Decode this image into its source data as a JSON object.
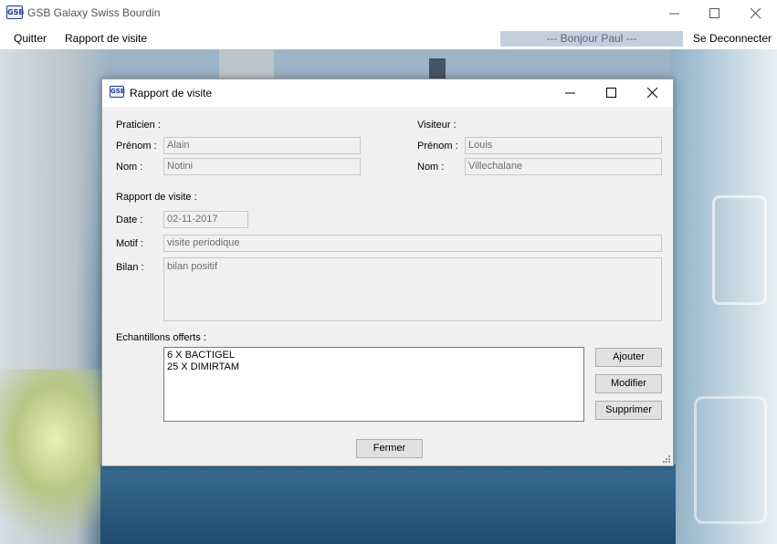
{
  "window": {
    "title": "GSB Galaxy Swiss Bourdin",
    "icon_label": "GSB"
  },
  "menu": {
    "quit": "Quitter",
    "report": "Rapport de visite",
    "greeting": "--- Bonjour Paul ---",
    "logout": "Se Deconnecter"
  },
  "dialog": {
    "title": "Rapport de visite",
    "icon_label": "GSB",
    "praticien": {
      "header": "Praticien :",
      "prenom_label": "Prénom :",
      "prenom": "Alain",
      "nom_label": "Nom :",
      "nom": "Notini"
    },
    "visiteur": {
      "header": "Visiteur :",
      "prenom_label": "Prénom :",
      "prenom": "Louis",
      "nom_label": "Nom :",
      "nom": "Villechalane"
    },
    "rapport": {
      "header": "Rapport de visite :",
      "date_label": "Date :",
      "date": "02-11-2017",
      "motif_label": "Motif :",
      "motif": "visite periodique",
      "bilan_label": "Bilan :",
      "bilan": "bilan positif"
    },
    "echantillons": {
      "header": "Echantillons offerts :",
      "items": [
        "6 X BACTIGEL",
        "25 X DIMIRTAM"
      ]
    },
    "buttons": {
      "ajouter": "Ajouter",
      "modifier": "Modifier",
      "supprimer": "Supprimer",
      "fermer": "Fermer"
    }
  }
}
